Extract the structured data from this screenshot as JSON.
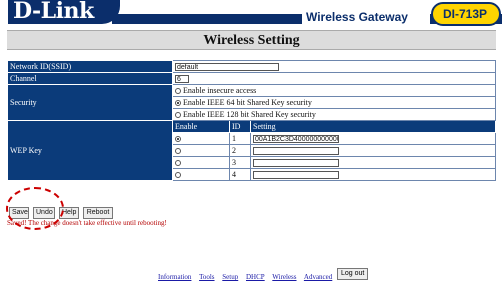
{
  "brand": {
    "logo_text": "D-Link",
    "product_line": "Wireless Gateway",
    "model": "DI-713P",
    "colors": {
      "navy": "#0b2e6b",
      "accent": "#ffd400"
    }
  },
  "page": {
    "title": "Wireless Setting"
  },
  "form": {
    "ssid_label": "Network ID(SSID)",
    "ssid_value": "default",
    "channel_label": "Channel",
    "channel_value": "6",
    "security_label": "Security",
    "security_options": [
      {
        "label": "Enable insecure access",
        "selected": false
      },
      {
        "label": "Enable IEEE 64 bit Shared Key security",
        "selected": true
      },
      {
        "label": "Enable IEEE 128 bit Shared Key security",
        "selected": false
      }
    ],
    "wep_label": "WEP Key",
    "wep_headers": {
      "enable": "Enable",
      "id": "ID",
      "setting": "Setting"
    },
    "wep_keys": [
      {
        "id": "1",
        "value": "00A1B2C3D40000000000000",
        "enabled": true
      },
      {
        "id": "2",
        "value": "",
        "enabled": false
      },
      {
        "id": "3",
        "value": "",
        "enabled": false
      },
      {
        "id": "4",
        "value": "",
        "enabled": false
      }
    ]
  },
  "buttons": {
    "save": "Save",
    "undo": "Undo",
    "help": "Help",
    "reboot": "Reboot"
  },
  "status_message": "Saved! The change doesn't take effective until rebooting!",
  "footer": {
    "links": [
      "Information",
      "Tools",
      "Setup",
      "DHCP",
      "Wireless",
      "Advanced"
    ],
    "logout": "Log out"
  }
}
